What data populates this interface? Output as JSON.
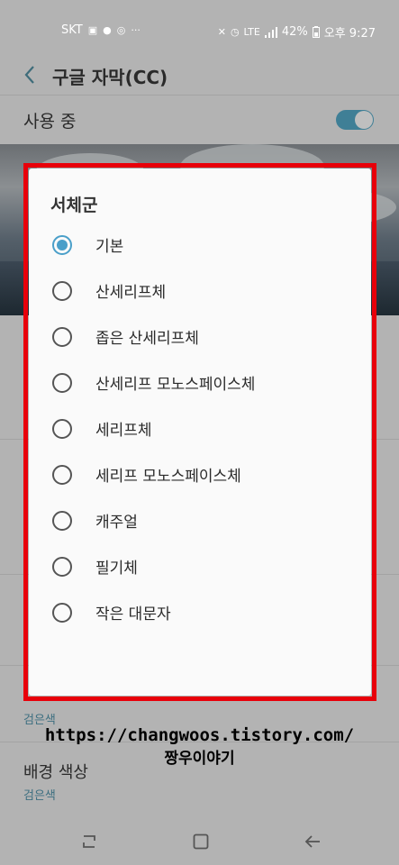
{
  "status_bar": {
    "carrier": "SKT",
    "network": "LTE",
    "battery": "42%",
    "time": "오후 9:27"
  },
  "header": {
    "title": "구글 자막(CC)"
  },
  "toggle": {
    "label": "사용 중",
    "on": true
  },
  "dialog": {
    "title": "서체군",
    "options": [
      {
        "label": "기본",
        "selected": true
      },
      {
        "label": "산세리프체",
        "selected": false
      },
      {
        "label": "좁은 산세리프체",
        "selected": false
      },
      {
        "label": "산세리프 모노스페이스체",
        "selected": false
      },
      {
        "label": "세리프체",
        "selected": false
      },
      {
        "label": "세리프 모노스페이스체",
        "selected": false
      },
      {
        "label": "캐주얼",
        "selected": false
      },
      {
        "label": "필기체",
        "selected": false
      },
      {
        "label": "작은 대문자",
        "selected": false
      }
    ]
  },
  "settings_below": {
    "partial_value": "검은색",
    "background_color": {
      "title": "배경 색상",
      "value": "검은색"
    }
  },
  "watermark": {
    "url": "https://changwoos.tistory.com/",
    "name": "짱우이야기"
  },
  "colors": {
    "accent": "#4a9fc9",
    "highlight_border": "#e8000a",
    "dim_background": "#b3b3b3"
  }
}
